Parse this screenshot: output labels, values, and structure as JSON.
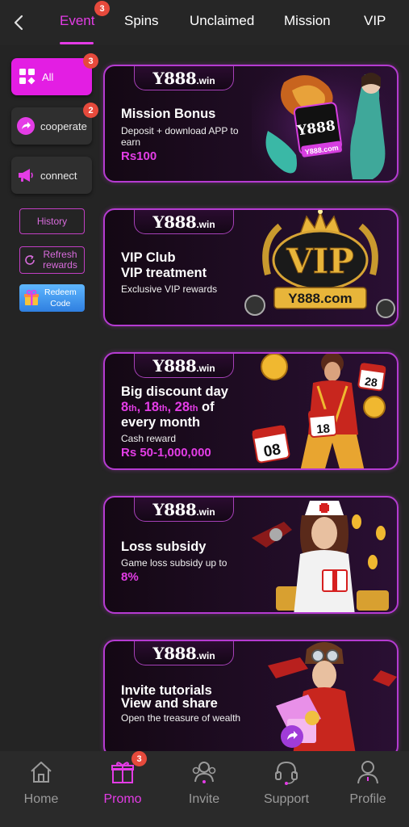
{
  "tabs": [
    {
      "label": "Event",
      "active": true,
      "badge": "3"
    },
    {
      "label": "Spins"
    },
    {
      "label": "Unclaimed"
    },
    {
      "label": "Mission"
    },
    {
      "label": "VIP"
    }
  ],
  "sidebar": {
    "all": {
      "label": "All",
      "badge": "3"
    },
    "cooperate": {
      "label": "cooperate",
      "badge": "2"
    },
    "connect": {
      "label": "connect"
    },
    "history": {
      "label": "History"
    },
    "refresh": {
      "label": "Refresh rewards"
    },
    "redeem": {
      "label_line1": "Redeem",
      "label_line2": "Code"
    }
  },
  "banners": [
    {
      "logo": "Y888",
      "logo_suffix": ".win",
      "title_lines": [
        "Mission Bonus"
      ],
      "sub_lines": [
        "Deposit + download APP to",
        "earn"
      ],
      "highlight_lines": [
        "Rs100"
      ],
      "art": "dragon-and-y888-card",
      "art_text": "Y888.com"
    },
    {
      "logo": "Y888",
      "logo_suffix": ".win",
      "title_lines": [
        "VIP Club",
        "VIP treatment"
      ],
      "sub_lines": [
        "Exclusive VIP rewards"
      ],
      "highlight_lines": [],
      "art": "vip-crown-emblem",
      "art_text": "Y888.com",
      "emblem_text": "VIP"
    },
    {
      "logo": "Y888",
      "logo_suffix": ".win",
      "title_lines": [
        "Big discount day",
        "8th, 18th, 28th of",
        "every month"
      ],
      "sub_lines": [
        "Cash reward"
      ],
      "highlight_lines": [
        "Rs 50-1,000,000"
      ],
      "art": "man-with-calendars",
      "calendar_days": [
        "28",
        "18",
        "08"
      ]
    },
    {
      "logo": "Y888",
      "logo_suffix": ".win",
      "title_lines": [
        "Loss subsidy"
      ],
      "sub_lines": [
        "Game loss subsidy up to"
      ],
      "highlight_lines": [
        "8%"
      ],
      "art": "nurse-with-coins"
    },
    {
      "logo": "Y888",
      "logo_suffix": ".win",
      "title_lines": [
        "Invite tutorials",
        "View and share"
      ],
      "sub_lines": [
        "Open the treasure of wealth"
      ],
      "highlight_lines": [],
      "art": "pilot-girl-with-gifts"
    }
  ],
  "bottom_nav": [
    {
      "label": "Home",
      "icon": "home-icon"
    },
    {
      "label": "Promo",
      "icon": "gift-icon",
      "active": true,
      "badge": "3"
    },
    {
      "label": "Invite",
      "icon": "people-icon"
    },
    {
      "label": "Support",
      "icon": "headset-icon"
    },
    {
      "label": "Profile",
      "icon": "person-icon"
    }
  ],
  "colors": {
    "accent": "#e43ce6",
    "badge": "#e64a3c",
    "background": "#242424"
  }
}
